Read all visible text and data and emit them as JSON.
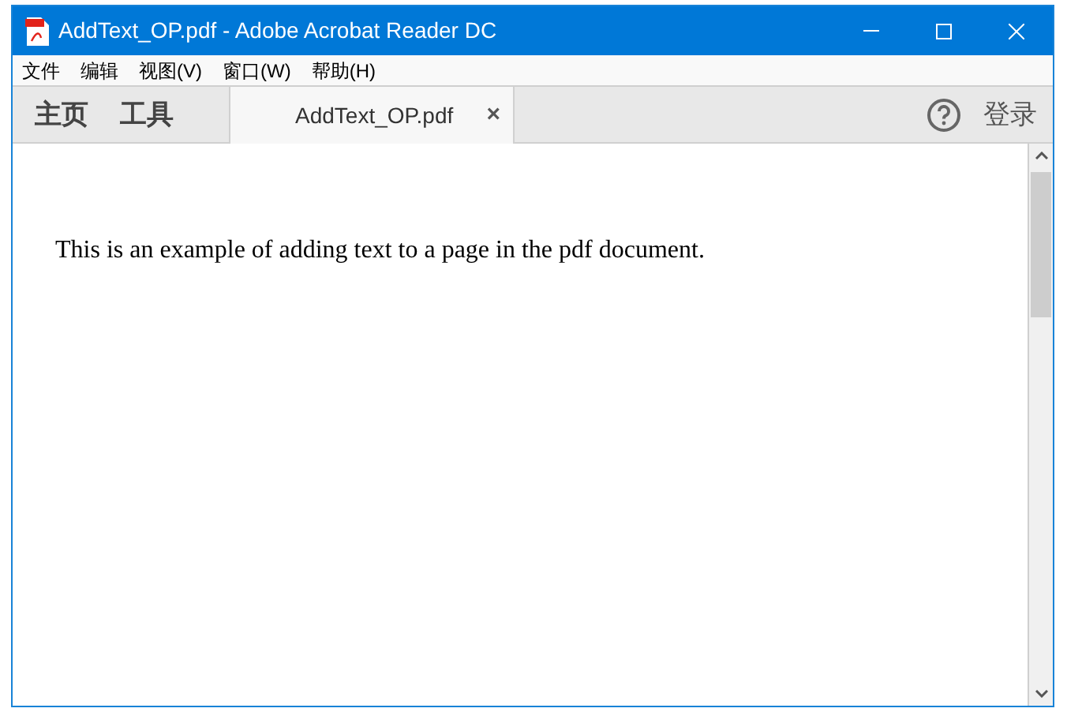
{
  "window": {
    "title": "AddText_OP.pdf - Adobe Acrobat Reader DC"
  },
  "menu": [
    "文件",
    "编辑",
    "视图(V)",
    "窗口(W)",
    "帮助(H)"
  ],
  "nav": [
    "主页",
    "工具"
  ],
  "tabs": [
    {
      "label": "AddText_OP.pdf",
      "close": "×",
      "selected": true
    }
  ],
  "sign_in": "登录",
  "document": {
    "text": "This is an example of adding text to a page in the pdf document."
  }
}
